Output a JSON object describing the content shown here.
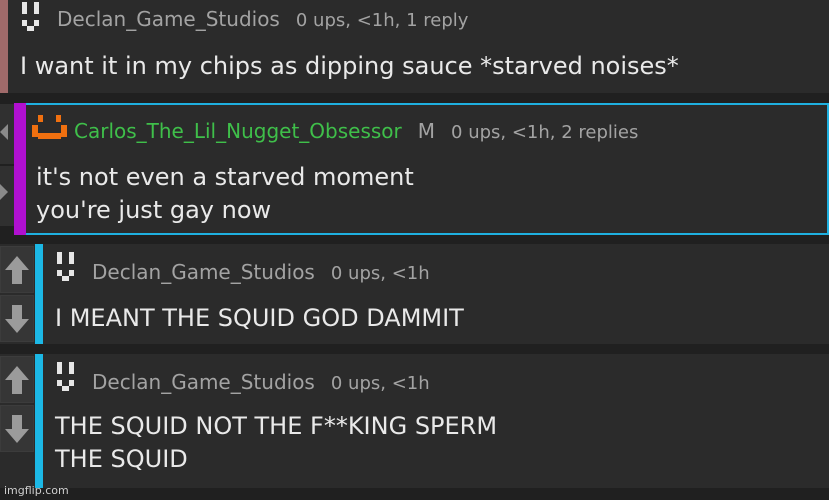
{
  "comments": [
    {
      "username": "Declan_Game_Studios",
      "stats": "0 ups, <1h, 1 reply",
      "lines": [
        "I want it in my chips as dipping sauce *starved noises*"
      ],
      "bar_color": "#a06a6a",
      "avatar_icon": "pixel-face-icon"
    },
    {
      "username": "Carlos_The_Lil_Nugget_Obsessor",
      "username_color": "#3fbf4a",
      "mod_badge": "M",
      "stats": "0 ups, <1h, 2 replies",
      "lines": [
        "it's not even a starved moment",
        "you're just gay now"
      ],
      "bar_color": "#b010d0",
      "border_color": "#1fb0e0",
      "avatar_icon": "orange-pixel-face-icon",
      "avatar_color": "#f07010"
    },
    {
      "username": "Declan_Game_Studios",
      "stats": "0 ups, <1h",
      "lines": [
        "I MEANT THE SQUID GOD DAMMIT"
      ],
      "bar_color": "#1cb8e6",
      "avatar_icon": "pixel-face-icon"
    },
    {
      "username": "Declan_Game_Studios",
      "stats": "0 ups, <1h",
      "lines": [
        "THE SQUID NOT THE F**KING SPERM",
        "THE SQUID"
      ],
      "bar_color": "#1cb8e6",
      "avatar_icon": "pixel-face-icon"
    }
  ],
  "watermark": "imgflip.com"
}
